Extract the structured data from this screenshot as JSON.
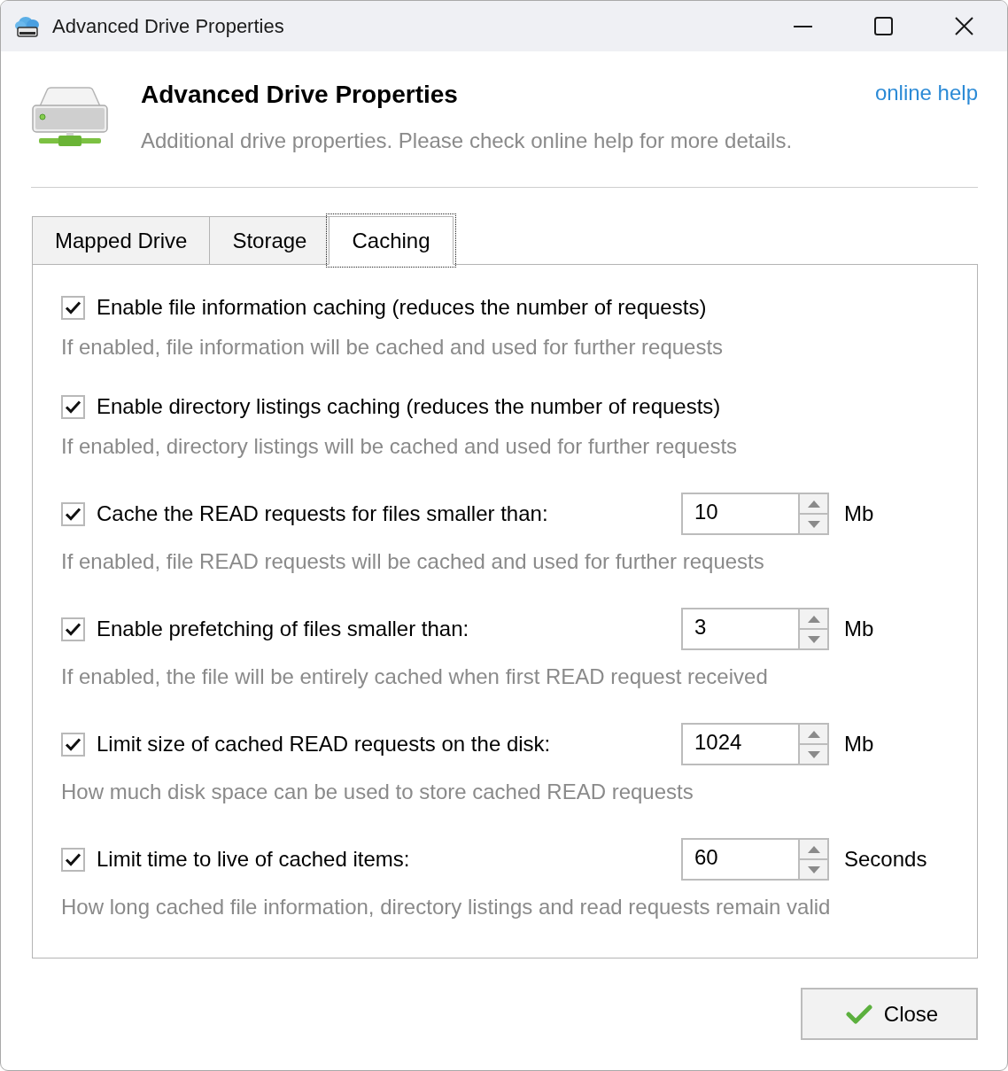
{
  "window": {
    "title": "Advanced Drive Properties"
  },
  "header": {
    "title": "Advanced Drive Properties",
    "subtitle": "Additional drive properties. Please check online help for more details.",
    "help_link": "online help"
  },
  "tabs": [
    {
      "label": "Mapped Drive",
      "selected": false,
      "focused": false
    },
    {
      "label": "Storage",
      "selected": false,
      "focused": false
    },
    {
      "label": "Caching",
      "selected": true,
      "focused": true
    }
  ],
  "options": [
    {
      "kind": "checkbox",
      "label": "Enable file information caching (reduces the number of requests)",
      "checked": true,
      "description": "If enabled, file information will be cached and used for further requests"
    },
    {
      "kind": "checkbox",
      "label": "Enable directory listings caching (reduces the number of requests)",
      "checked": true,
      "description": "If enabled, directory listings will be cached and used for further requests"
    },
    {
      "kind": "number",
      "label": "Cache the READ requests for files smaller than:",
      "checked": true,
      "value": "10",
      "unit": "Mb",
      "description": "If enabled, file READ requests will be cached and used for further requests"
    },
    {
      "kind": "number",
      "label": "Enable prefetching of files smaller than:",
      "checked": true,
      "value": "3",
      "unit": "Mb",
      "description": "If enabled, the file will be entirely cached when first READ request received"
    },
    {
      "kind": "number",
      "label": "Limit size of cached READ requests on the disk:",
      "checked": true,
      "value": "1024",
      "unit": "Mb",
      "description": "How much disk space can be used to store cached READ requests"
    },
    {
      "kind": "number",
      "label": "Limit time to live of cached items:",
      "checked": true,
      "value": "60",
      "unit": "Seconds",
      "description": "How long cached file information, directory listings and read requests remain valid"
    }
  ],
  "buttons": [
    {
      "label": "Close"
    }
  ]
}
